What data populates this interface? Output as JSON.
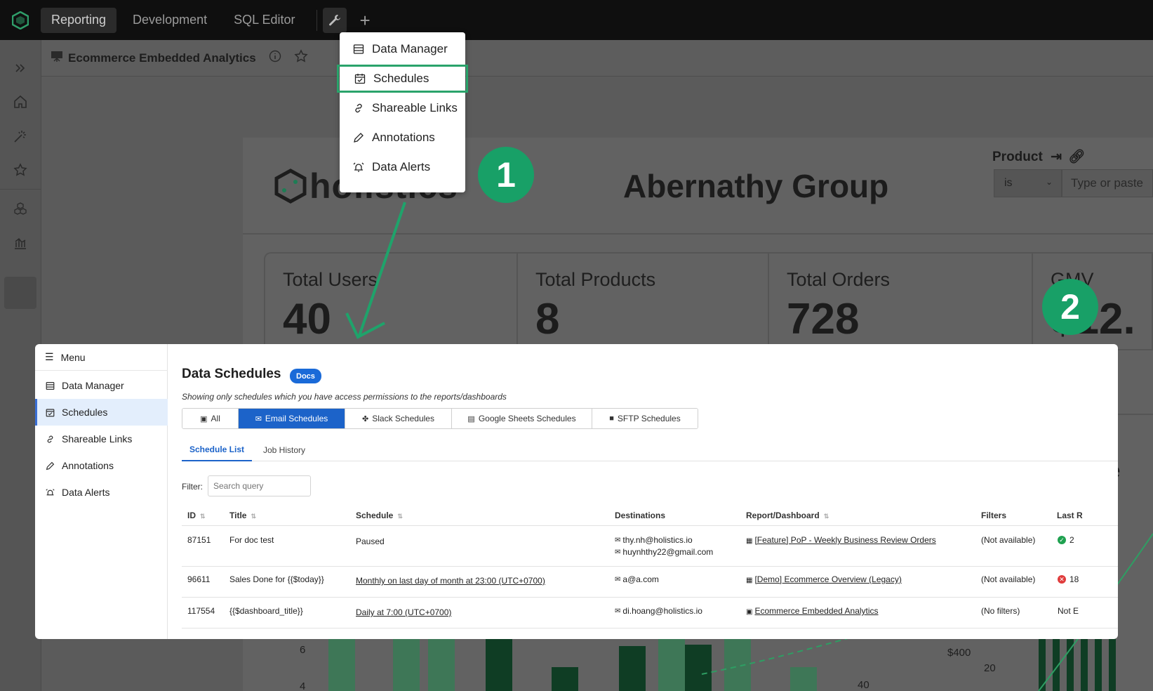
{
  "topbar": {
    "tabs": [
      "Reporting",
      "Development",
      "SQL Editor"
    ],
    "active_tab": "Reporting",
    "plus": "+"
  },
  "subheader": {
    "title": "Ecommerce Embedded Analytics"
  },
  "dashboard": {
    "logo_text": "holistics",
    "company": "Abernathy Group",
    "filter_label": "Product",
    "operator": "is",
    "input_placeholder": "Type or paste",
    "kpis": [
      {
        "label": "Total Users",
        "value": "40"
      },
      {
        "label": "Total Products",
        "value": "8"
      },
      {
        "label": "Total Orders",
        "value": "728"
      },
      {
        "label": "GMV",
        "value": "$12."
      }
    ],
    "axis_labels": [
      "6",
      "4",
      "40",
      "$400",
      "20"
    ]
  },
  "tools_menu": {
    "items": [
      "Data Manager",
      "Schedules",
      "Shareable Links",
      "Annotations",
      "Data Alerts"
    ],
    "highlighted": "Schedules"
  },
  "badges": [
    "1",
    "2"
  ],
  "schedules_panel": {
    "menu_label": "Menu",
    "menu_items": [
      "Data Manager",
      "Schedules",
      "Shareable Links",
      "Annotations",
      "Data Alerts"
    ],
    "selected_item": "Schedules",
    "title": "Data Schedules",
    "docs_badge": "Docs",
    "note": "Showing only schedules which you have access permissions to the reports/dashboards",
    "type_tabs": [
      "All",
      "Email Schedules",
      "Slack Schedules",
      "Google Sheets Schedules",
      "SFTP Schedules"
    ],
    "active_type": "Email Schedules",
    "sub_tabs": [
      "Schedule List",
      "Job History"
    ],
    "active_sub_tab": "Schedule List",
    "filter_label": "Filter:",
    "filter_placeholder": "Search query",
    "columns": [
      "ID",
      "Title",
      "Schedule",
      "Destinations",
      "Report/Dashboard",
      "Filters",
      "Last R"
    ],
    "rows": [
      {
        "id": "87151",
        "title": "For doc test",
        "schedule": "Paused",
        "destinations": [
          "thy.nh@holistics.io",
          "huynhthy22@gmail.com"
        ],
        "report": "[Feature] PoP - Weekly Business Review Orders",
        "filters": "(Not available)",
        "last_run": "2",
        "status": "success"
      },
      {
        "id": "96611",
        "title": "Sales Done for {{$today}}",
        "schedule": "Monthly on last day of month at 23:00 (UTC+0700)",
        "destinations": [
          "a@a.com"
        ],
        "report": "[Demo] Ecommerce Overview (Legacy)",
        "filters": "(Not available)",
        "last_run": "18",
        "status": "error"
      },
      {
        "id": "117554",
        "title": "{{$dashboard_title}}",
        "schedule": "Daily at 7:00 (UTC+0700)",
        "destinations": [
          "di.hoang@holistics.io"
        ],
        "report": "Ecommerce Embedded Analytics",
        "filters": "(No filters)",
        "last_run": "Not E",
        "status": "none"
      }
    ]
  },
  "colors": {
    "accent": "#18a067",
    "primary_blue": "#1c63c9",
    "success": "#1fa150",
    "error": "#e03b3b"
  }
}
